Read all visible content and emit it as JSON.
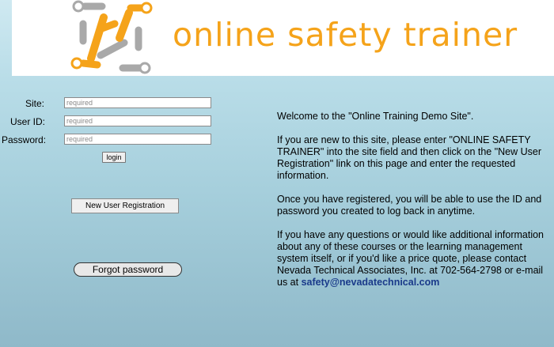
{
  "brand": {
    "name": "online safety trainer",
    "color": "#f5a31a",
    "logo_icon": "linked-wrench-logo-icon"
  },
  "login_form": {
    "site_label": "Site:",
    "site_placeholder": "required",
    "userid_label": "User ID:",
    "userid_placeholder": "required",
    "password_label": "Password:",
    "password_placeholder": "required",
    "login_button": "login"
  },
  "new_user_button": "New User Registration",
  "forgot_button": "Forgot password",
  "info": {
    "welcome": "Welcome to the \"Online Training Demo Site\".",
    "new_user_text": "If you are new to this site, please enter \"ONLINE SAFETY TRAINER\" into the site field and then click on the \"New User Registration\" link on this page and enter the requested information.",
    "registered_text": "Once you have registered, you will be able to use the ID and password you created to log back in anytime.",
    "questions_text": "If you have any questions or would like additional information about any of these courses or the learning management system itself, or if you'd like a price quote, please contact Nevada Technical Associates, Inc. at 702-564-2798 or e-mail us at",
    "email": "safety@nevadatechnical.com"
  },
  "colors": {
    "email_link": "#1a3a8a",
    "logo_gray": "#a9a9a9"
  }
}
